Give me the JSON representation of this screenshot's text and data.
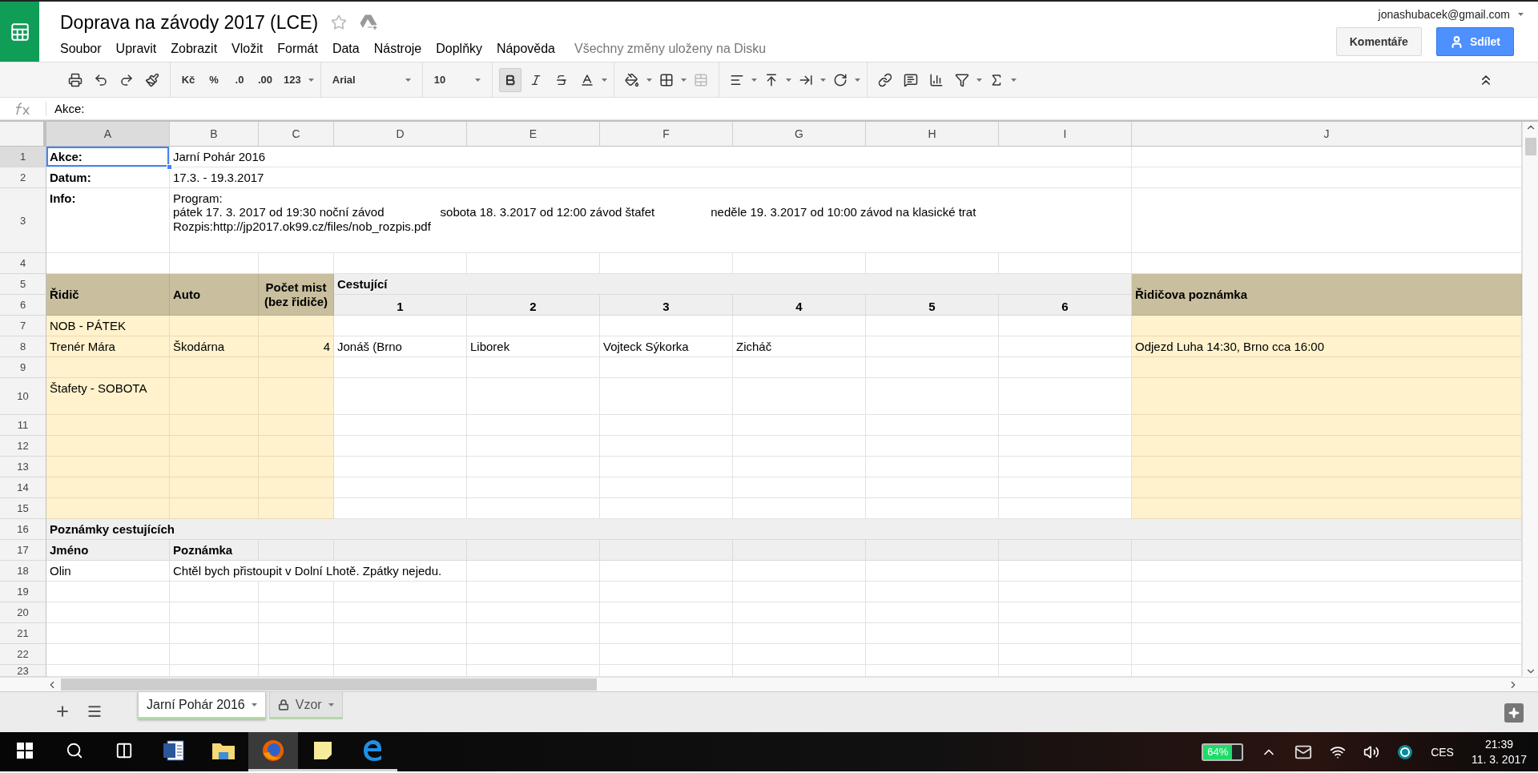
{
  "document": {
    "title": "Doprava na závody 2017 (LCE)",
    "starred": false
  },
  "account": {
    "email": "jonashubacek@gmail.com"
  },
  "menu": [
    "Soubor",
    "Upravit",
    "Zobrazit",
    "Vložit",
    "Formát",
    "Data",
    "Nástroje",
    "Doplňky",
    "Nápověda"
  ],
  "save_status": "Všechny změny uloženy na Disku",
  "buttons": {
    "comments": "Komentáře",
    "share": "Sdílet"
  },
  "toolbar": {
    "currency": "Kč",
    "percent": "%",
    "decrease_decimals": ".0",
    "increase_decimals": ".00",
    "number_format": "123",
    "font": "Arial",
    "font_size": "10",
    "bold": true,
    "italic": false,
    "strikethrough": false
  },
  "formula_bar": {
    "value": "Akce:"
  },
  "sheet": {
    "columns": [
      "A",
      "B",
      "C",
      "D",
      "E",
      "F",
      "G",
      "H",
      "I",
      "J"
    ],
    "rows": [
      {
        "number": "1",
        "cells": {
          "A": {
            "text": "Akce:",
            "bold": true,
            "kind": "text",
            "selected": true
          },
          "B": {
            "text": "Jarní Pohár 2016",
            "bold": false,
            "kind": "text",
            "selected": false
          }
        }
      },
      {
        "number": "2",
        "cells": {
          "A": {
            "text": "Datum:",
            "bold": true,
            "kind": "text",
            "selected": false
          },
          "B": {
            "text": "17.3. - 19.3.2017",
            "bold": false,
            "kind": "text",
            "selected": false
          }
        }
      },
      {
        "number": "3",
        "cells": {
          "A": {
            "text": "Info:",
            "bold": true,
            "kind": "text",
            "selected": false
          },
          "B": {
            "lines": [
              [
                "Program:"
              ],
              [
                "pátek  17. 3. 2017 od 19:30 noční závod",
                "sobota 18. 3.2017 od 12:00 závod štafet",
                "neděle 19. 3.2017 od 10:00 závod na klasické trat"
              ],
              [
                "Rozpis:http://jp2017.ok99.cz/files/nob_rozpis.pdf"
              ]
            ],
            "bold": false,
            "kind": "text",
            "selected": false
          }
        }
      },
      {
        "number": "4"
      },
      {
        "number": "5",
        "cells": {
          "A": {
            "text": "Řidič",
            "bold": true,
            "kind": "text",
            "selected": false
          },
          "B": {
            "text": "Auto",
            "bold": true,
            "kind": "text",
            "selected": false
          },
          "C": {
            "text": "Počet mist (bez řidiče)",
            "bold": true,
            "kind": "heading",
            "selected": false
          },
          "D": {
            "text": "Cestující",
            "bold": true,
            "kind": "text",
            "selected": false
          },
          "J": {
            "text": "Řidičova poznámka",
            "bold": true,
            "kind": "text",
            "selected": false
          }
        }
      },
      {
        "number": "6",
        "cells": {
          "D": {
            "text": "1",
            "bold": true,
            "kind": "heading",
            "selected": false
          },
          "E": {
            "text": "2",
            "bold": true,
            "kind": "heading",
            "selected": false
          },
          "F": {
            "text": "3",
            "bold": true,
            "kind": "heading",
            "selected": false
          },
          "G": {
            "text": "4",
            "bold": true,
            "kind": "heading",
            "selected": false
          },
          "H": {
            "text": "5",
            "bold": true,
            "kind": "heading",
            "selected": false
          },
          "I": {
            "text": "6",
            "bold": true,
            "kind": "heading",
            "selected": false
          }
        }
      },
      {
        "number": "7",
        "cells": {
          "A": {
            "text": "NOB - PÁTEK",
            "bold": false,
            "kind": "text",
            "selected": false
          }
        }
      },
      {
        "number": "8",
        "cells": {
          "A": {
            "text": "Trenér Mára",
            "bold": false,
            "kind": "text",
            "selected": false
          },
          "B": {
            "text": "Škodárna",
            "bold": false,
            "kind": "text",
            "selected": false
          },
          "C": {
            "text": "4",
            "bold": false,
            "kind": "number",
            "selected": false
          },
          "D": {
            "text": "Jonáš (Brno",
            "bold": false,
            "kind": "text",
            "selected": false
          },
          "E": {
            "text": "Liborek",
            "bold": false,
            "kind": "text",
            "selected": false
          },
          "F": {
            "text": "Vojteck Sýkorka",
            "bold": false,
            "kind": "text",
            "selected": false
          },
          "G": {
            "text": "Zicháč",
            "bold": false,
            "kind": "text",
            "selected": false
          },
          "J": {
            "text": "Odjezd Luha 14:30, Brno cca 16:00",
            "bold": false,
            "kind": "text",
            "selected": false
          }
        }
      },
      {
        "number": "9"
      },
      {
        "number": "10",
        "cells": {
          "A": {
            "text": "Štafety - SOBOTA",
            "bold": false,
            "kind": "text",
            "selected": false
          }
        }
      },
      {
        "number": "11"
      },
      {
        "number": "12"
      },
      {
        "number": "13"
      },
      {
        "number": "14"
      },
      {
        "number": "15"
      },
      {
        "number": "16",
        "cells": {
          "A": {
            "text": "Poznámky cestujících",
            "bold": true,
            "kind": "text",
            "selected": false
          }
        }
      },
      {
        "number": "17",
        "cells": {
          "A": {
            "text": "Jméno",
            "bold": true,
            "kind": "text",
            "selected": false
          },
          "B": {
            "text": "Poznámka",
            "bold": true,
            "kind": "text",
            "selected": false
          }
        }
      },
      {
        "number": "18",
        "cells": {
          "A": {
            "text": "Olin",
            "bold": false,
            "kind": "text",
            "selected": false
          },
          "B": {
            "text": "Chtěl bych přistoupit v Dolní Lhotě. Zpátky nejedu.",
            "bold": false,
            "kind": "text",
            "selected": false
          }
        }
      },
      {
        "number": "19"
      },
      {
        "number": "20"
      },
      {
        "number": "21"
      },
      {
        "number": "22"
      },
      {
        "number": "23"
      }
    ]
  },
  "sheet_tabs": [
    {
      "label": "Jarní Pohár 2016",
      "selected": true,
      "locked": false
    },
    {
      "label": "Vzor",
      "selected": false,
      "locked": true
    }
  ],
  "taskbar": {
    "apps": [
      {
        "kind": "document",
        "running": false,
        "active": false
      },
      {
        "kind": "folder",
        "running": false,
        "active": false
      },
      {
        "kind": "browser",
        "running": true,
        "active": true
      },
      {
        "kind": "notes",
        "running": true,
        "active": false
      },
      {
        "kind": "web",
        "running": true,
        "active": false
      }
    ],
    "battery": "64%",
    "language": "CES",
    "time": "21:39",
    "date": "11. 3. 2017"
  }
}
